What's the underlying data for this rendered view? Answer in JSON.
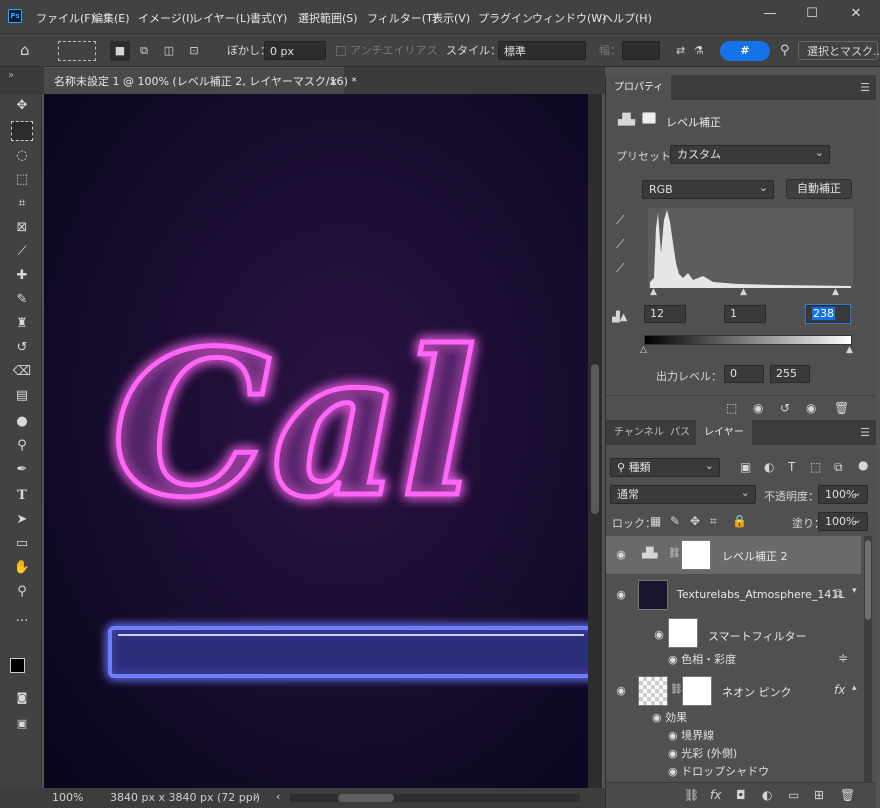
{
  "app": {
    "logo": "Ps"
  },
  "menu": [
    "ファイル(F)",
    "編集(E)",
    "イメージ(I)",
    "レイヤー(L)",
    "書式(Y)",
    "選択範囲(S)",
    "フィルター(T)",
    "表示(V)",
    "プラグイン",
    "ウィンドウ(W)",
    "ヘルプ(H)"
  ],
  "options": {
    "feather_label": "ぼかし：",
    "feather_value": "0 px",
    "antialias_label": "アンチエイリアス",
    "style_label": "スタイル：",
    "style_value": "標準",
    "width_label": "幅：",
    "select_mask_label": "選択とマスク..."
  },
  "document": {
    "tab_title": "名称未設定 1 @ 100% (レベル補正 2, レイヤーマスク/16) *",
    "zoom": "100%",
    "info": "3840 px x 3840 px (72 ppi)",
    "neon_text": "Cal"
  },
  "properties": {
    "tab": "プロパティ",
    "title": "レベル補正",
    "preset_label": "プリセット：",
    "preset_value": "カスタム",
    "channel_value": "RGB",
    "auto_label": "自動補正",
    "input_black": "12",
    "input_mid": "1",
    "input_white": "238",
    "output_label": "出力レベル：",
    "output_black": "0",
    "output_white": "255"
  },
  "layers_panel": {
    "tabs": [
      "チャンネル",
      "パス",
      "レイヤー"
    ],
    "filter_kind": "種類",
    "blend_mode": "通常",
    "opacity_label": "不透明度：",
    "opacity_value": "100%",
    "lock_label": "ロック：",
    "fill_label": "塗り：",
    "fill_value": "100%",
    "layers": [
      {
        "name": "レベル補正 2"
      },
      {
        "name": "Texturelabs_Atmosphere_141L"
      },
      {
        "name": "スマートフィルター"
      },
      {
        "name": "色相・彩度"
      },
      {
        "name": "ネオン ピンク"
      },
      {
        "name": "効果"
      },
      {
        "name": "境界線"
      },
      {
        "name": "光彩 (外側)"
      },
      {
        "name": "ドロップシャドウ"
      }
    ]
  },
  "colors": {
    "accent": "#1473e6",
    "neon_pink": "#ff5cf4",
    "neon_blue": "#5a6cff"
  }
}
